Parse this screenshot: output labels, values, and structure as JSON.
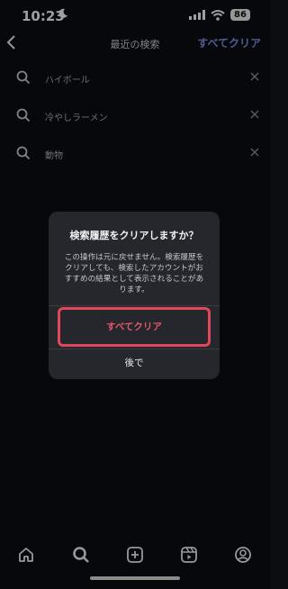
{
  "status": {
    "time": "10:23",
    "battery": "86"
  },
  "header": {
    "title": "最近の検索",
    "clear_all": "すべてクリア"
  },
  "history": [
    {
      "label": "ハイボール"
    },
    {
      "label": "冷やしラーメン"
    },
    {
      "label": "動物"
    }
  ],
  "dialog": {
    "title": "検索履歴をクリアしますか？",
    "message": "この操作は元に戻せません。検索履歴をクリアしても、検索したアカウントがおすすめの結果として表示されることがあります。",
    "confirm": "すべてクリア",
    "cancel": "後で"
  },
  "colors": {
    "accent": "#7b8ee0",
    "destructive": "#e4576b",
    "highlight_border": "#e0475a"
  },
  "nav": [
    "home-icon",
    "search-icon",
    "create-icon",
    "reels-icon",
    "profile-icon"
  ]
}
